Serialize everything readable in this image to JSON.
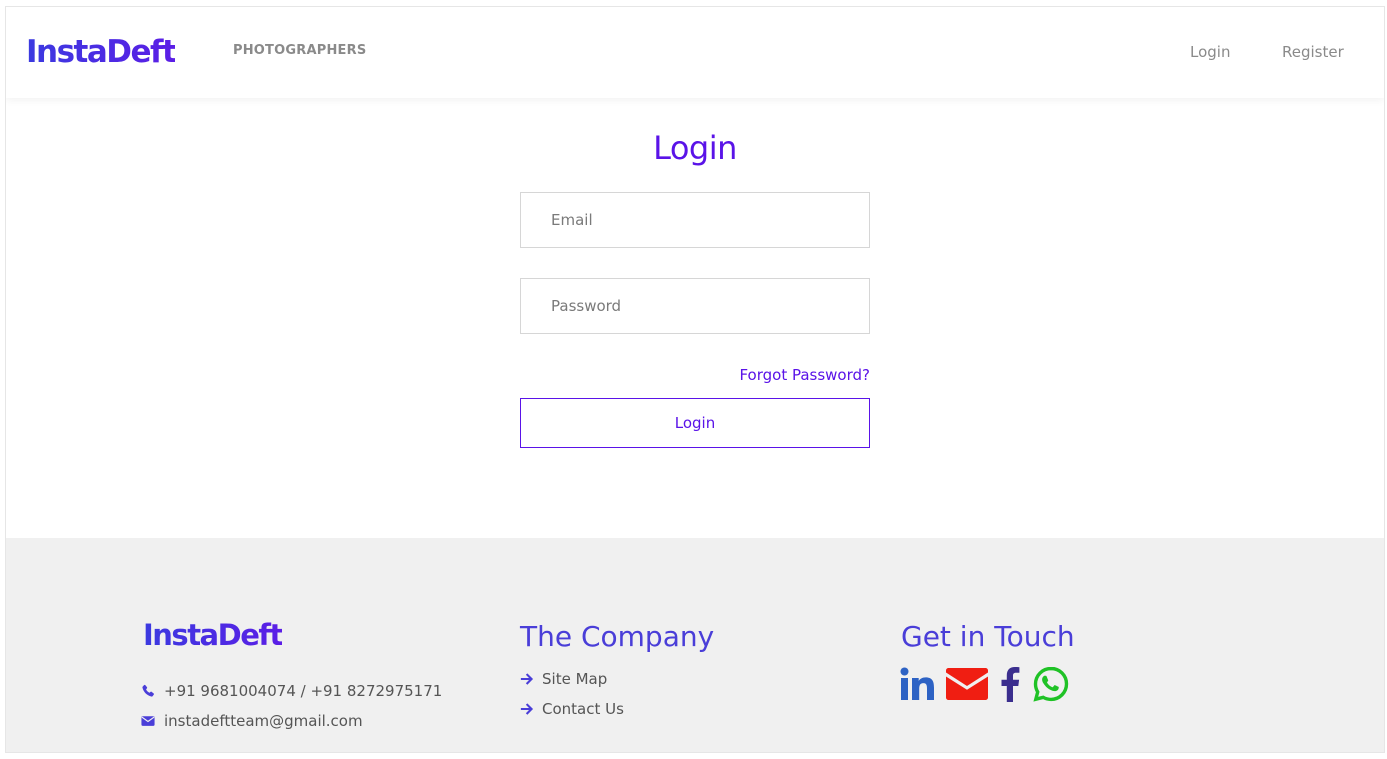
{
  "header": {
    "brand": "InstaDeft",
    "nav_left": "PHOTOGRAPHERS",
    "nav_login": "Login",
    "nav_register": "Register"
  },
  "login": {
    "title": "Login",
    "email_placeholder": "Email",
    "password_placeholder": "Password",
    "forgot": "Forgot Password?",
    "button": "Login"
  },
  "footer": {
    "brand": "InstaDeft",
    "phone": "+91 9681004074 / +91 8272975171",
    "email": "instadeftteam@gmail.com",
    "company_title": "The Company",
    "company_links": [
      "Site Map",
      "Contact Us"
    ],
    "touch_title": "Get in Touch",
    "social": [
      "linkedin-icon",
      "email-icon",
      "facebook-icon",
      "whatsapp-icon"
    ]
  },
  "colors": {
    "accent": "#5a13e8",
    "footer_heading": "#4a3ed8",
    "linkedin": "#2d62c4",
    "email_social": "#f01e12",
    "facebook": "#3b2e8e",
    "whatsapp": "#1fc226"
  }
}
